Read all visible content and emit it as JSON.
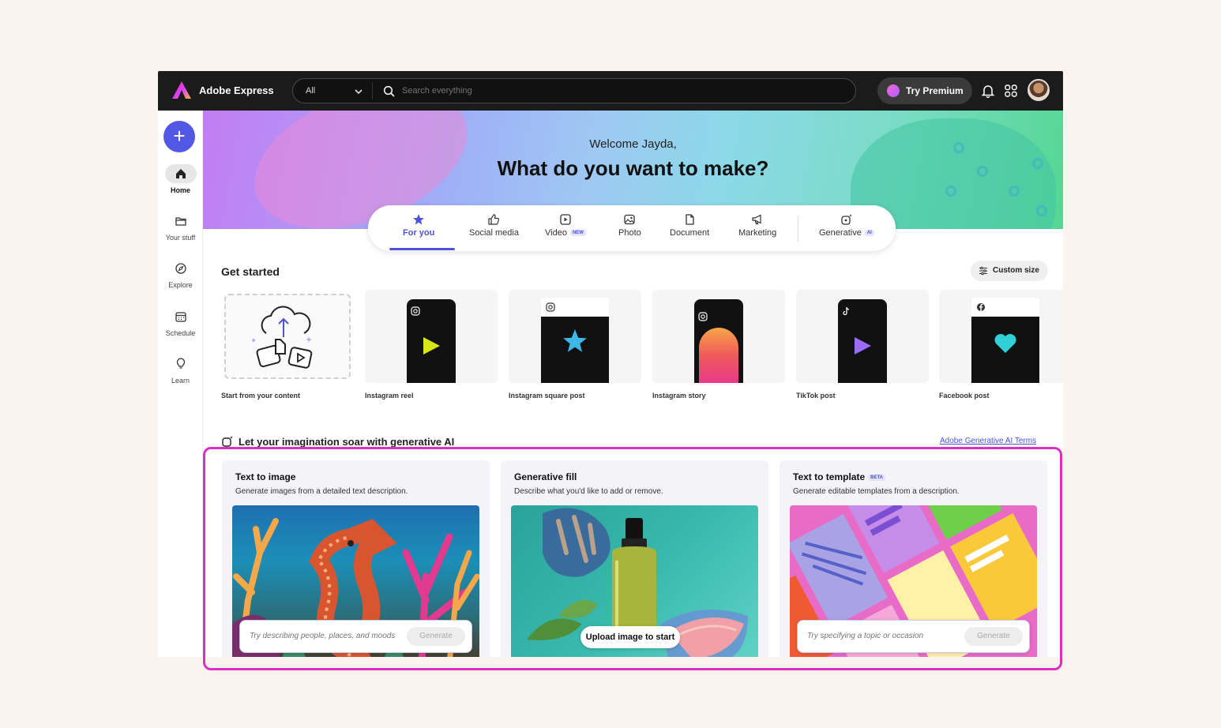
{
  "app": {
    "brand": "Adobe Express"
  },
  "search": {
    "category": "All",
    "placeholder": "Search everything"
  },
  "header": {
    "premium_label": "Try Premium"
  },
  "sidebar": {
    "items": [
      {
        "label": "Home",
        "icon": "home-icon"
      },
      {
        "label": "Your stuff",
        "icon": "folder-icon"
      },
      {
        "label": "Explore",
        "icon": "compass-icon"
      },
      {
        "label": "Schedule",
        "icon": "calendar-icon"
      },
      {
        "label": "Learn",
        "icon": "lightbulb-icon"
      }
    ]
  },
  "hero": {
    "welcome": "Welcome Jayda,",
    "headline": "What do you want to make?"
  },
  "tabs": [
    {
      "label": "For you"
    },
    {
      "label": "Social media"
    },
    {
      "label": "Video",
      "badge": "NEW"
    },
    {
      "label": "Photo"
    },
    {
      "label": "Document"
    },
    {
      "label": "Marketing"
    },
    {
      "label": "Generative",
      "badge": "AI"
    }
  ],
  "get_started": {
    "title": "Get started",
    "custom_size": "Custom size",
    "cards": [
      {
        "label": "Start from your content"
      },
      {
        "label": "Instagram reel"
      },
      {
        "label": "Instagram square post"
      },
      {
        "label": "Instagram story"
      },
      {
        "label": "TikTok post"
      },
      {
        "label": "Facebook post"
      }
    ]
  },
  "generative": {
    "title": "Let your imagination soar with generative AI",
    "terms_link": "Adobe Generative AI Terms",
    "cards": [
      {
        "title": "Text to image",
        "desc": "Generate images from a detailed text description.",
        "placeholder": "Try describing people, places, and moods",
        "button": "Generate"
      },
      {
        "title": "Generative fill",
        "desc": "Describe what you'd like to add or remove.",
        "button": "Upload image to start"
      },
      {
        "title": "Text to template",
        "badge": "BETA",
        "desc": "Generate editable templates from a description.",
        "placeholder": "Try specifying a topic or occasion",
        "button": "Generate"
      }
    ]
  },
  "colors": {
    "accent": "#4d52d9",
    "highlight": "#dc2fc8",
    "topbar": "#1b1b1b"
  }
}
